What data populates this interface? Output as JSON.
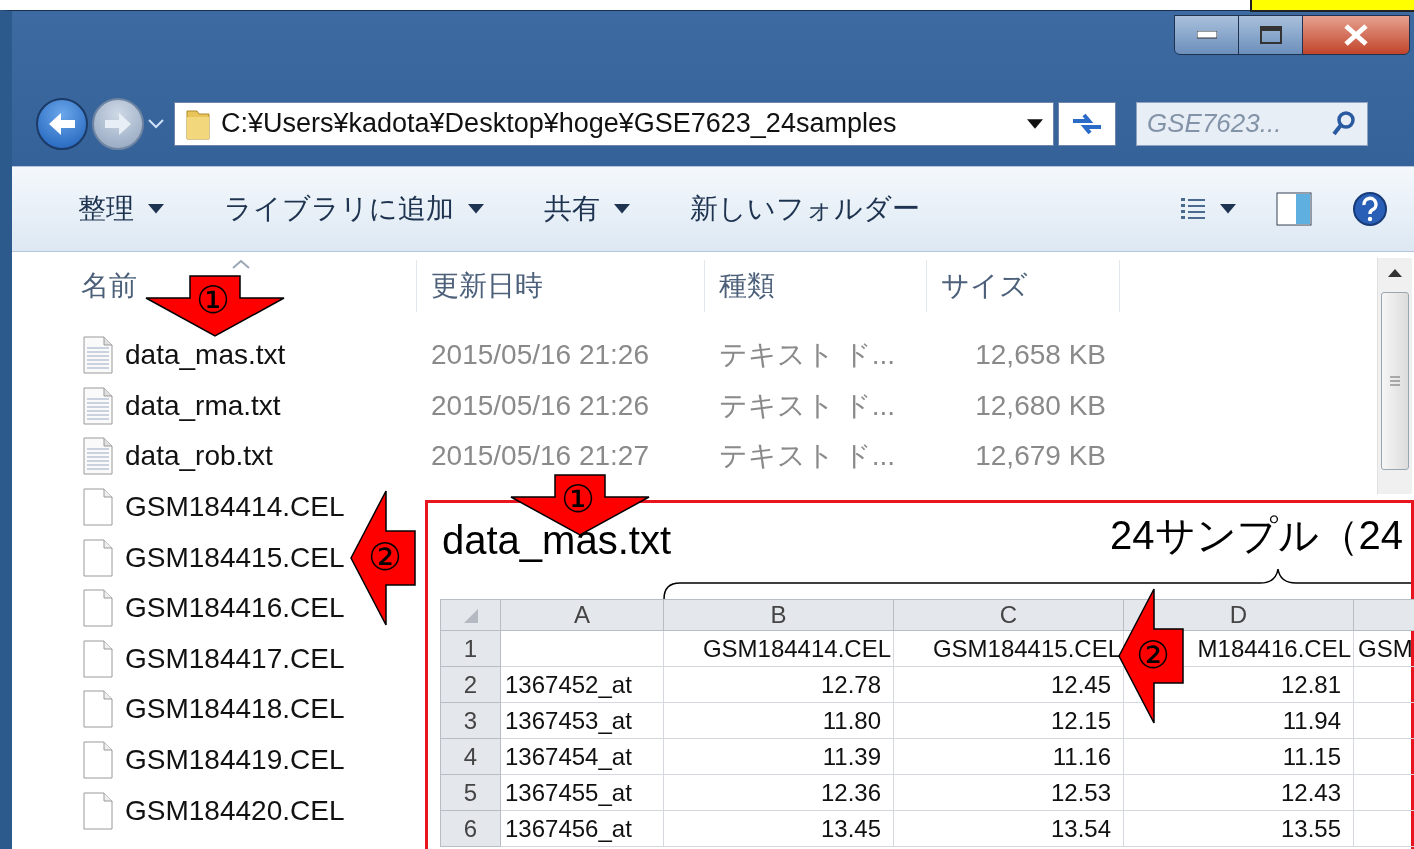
{
  "address_bar": {
    "path": "C:¥Users¥kadota¥Desktop¥hoge¥GSE7623_24samples"
  },
  "search": {
    "placeholder": "GSE7623..."
  },
  "toolbar": [
    {
      "label": "整理",
      "dropdown": true
    },
    {
      "label": "ライブラリに追加",
      "dropdown": true
    },
    {
      "label": "共有",
      "dropdown": true
    },
    {
      "label": "新しいフォルダー",
      "dropdown": false
    }
  ],
  "columns": [
    {
      "label": "名前",
      "sorted": true
    },
    {
      "label": "更新日時",
      "sorted": false
    },
    {
      "label": "種類",
      "sorted": false
    },
    {
      "label": "サイズ",
      "sorted": false
    }
  ],
  "files": [
    {
      "kind": "text",
      "name": "data_mas.txt",
      "modified": "2015/05/16 21:26",
      "type": "テキスト ド...",
      "size": "12,658 KB"
    },
    {
      "kind": "text",
      "name": "data_rma.txt",
      "modified": "2015/05/16 21:26",
      "type": "テキスト ド...",
      "size": "12,680 KB"
    },
    {
      "kind": "text",
      "name": "data_rob.txt",
      "modified": "2015/05/16 21:27",
      "type": "テキスト ド...",
      "size": "12,679 KB"
    },
    {
      "kind": "file",
      "name": "GSM184414.CEL"
    },
    {
      "kind": "file",
      "name": "GSM184415.CEL"
    },
    {
      "kind": "file",
      "name": "GSM184416.CEL"
    },
    {
      "kind": "file",
      "name": "GSM184417.CEL"
    },
    {
      "kind": "file",
      "name": "GSM184418.CEL"
    },
    {
      "kind": "file",
      "name": "GSM184419.CEL"
    },
    {
      "kind": "file",
      "name": "GSM184420.CEL"
    }
  ],
  "inset": {
    "title": "data_mas.txt",
    "caption": "24サンプル（24",
    "sheet": {
      "columns": [
        "A",
        "B",
        "C",
        "D"
      ],
      "header_row": {
        "number": "1",
        "cells": [
          "GSM184414.CEL",
          "GSM184415.CEL",
          "M184416.CEL",
          "GSM"
        ]
      },
      "rows": [
        {
          "number": "2",
          "id": "1367452_at",
          "values": [
            "12.78",
            "12.45",
            "12.81"
          ]
        },
        {
          "number": "3",
          "id": "1367453_at",
          "values": [
            "11.80",
            "12.15",
            "11.94"
          ]
        },
        {
          "number": "4",
          "id": "1367454_at",
          "values": [
            "11.39",
            "11.16",
            "11.15"
          ]
        },
        {
          "number": "5",
          "id": "1367455_at",
          "values": [
            "12.36",
            "12.53",
            "12.43"
          ]
        },
        {
          "number": "6",
          "id": "1367456_at",
          "values": [
            "13.45",
            "13.54",
            "13.55"
          ]
        }
      ]
    }
  },
  "annotations": [
    {
      "kind": "down",
      "label": "①"
    },
    {
      "kind": "down",
      "label": "①"
    },
    {
      "kind": "left",
      "label": "②"
    },
    {
      "kind": "left",
      "label": "②"
    }
  ]
}
